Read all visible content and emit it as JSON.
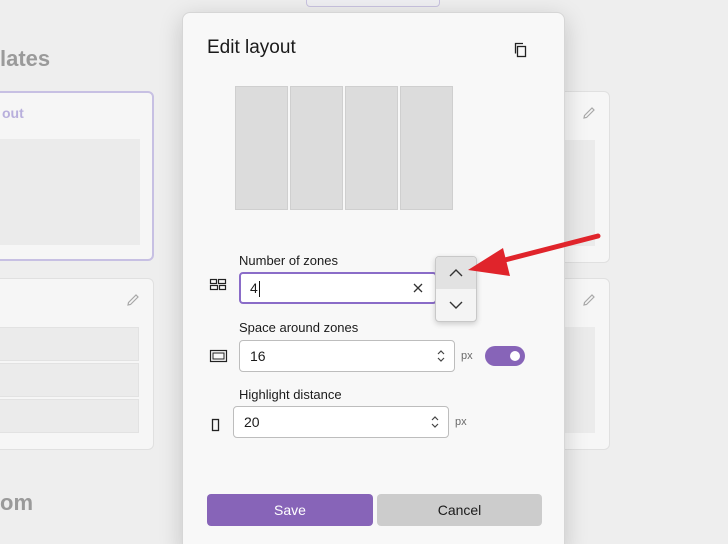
{
  "background": {
    "heading_partial": "lates",
    "bottom_heading_partial": "om",
    "selected_card_title_partial": "out"
  },
  "dialog": {
    "title": "Edit layout",
    "zone_count_preview": 4,
    "number_of_zones": {
      "label": "Number of zones",
      "value": "4",
      "icon": "grid-layout-icon"
    },
    "space_around_zones": {
      "label": "Space around zones",
      "value": "16",
      "unit": "px",
      "toggle_on": true,
      "icon": "border-rectangle-icon"
    },
    "highlight_distance": {
      "label": "Highlight distance",
      "value": "20",
      "unit": "px",
      "icon": "narrow-rectangle-icon"
    },
    "save_label": "Save",
    "cancel_label": "Cancel"
  },
  "colors": {
    "accent": "#8764b8",
    "annotation": "#e0242b"
  }
}
